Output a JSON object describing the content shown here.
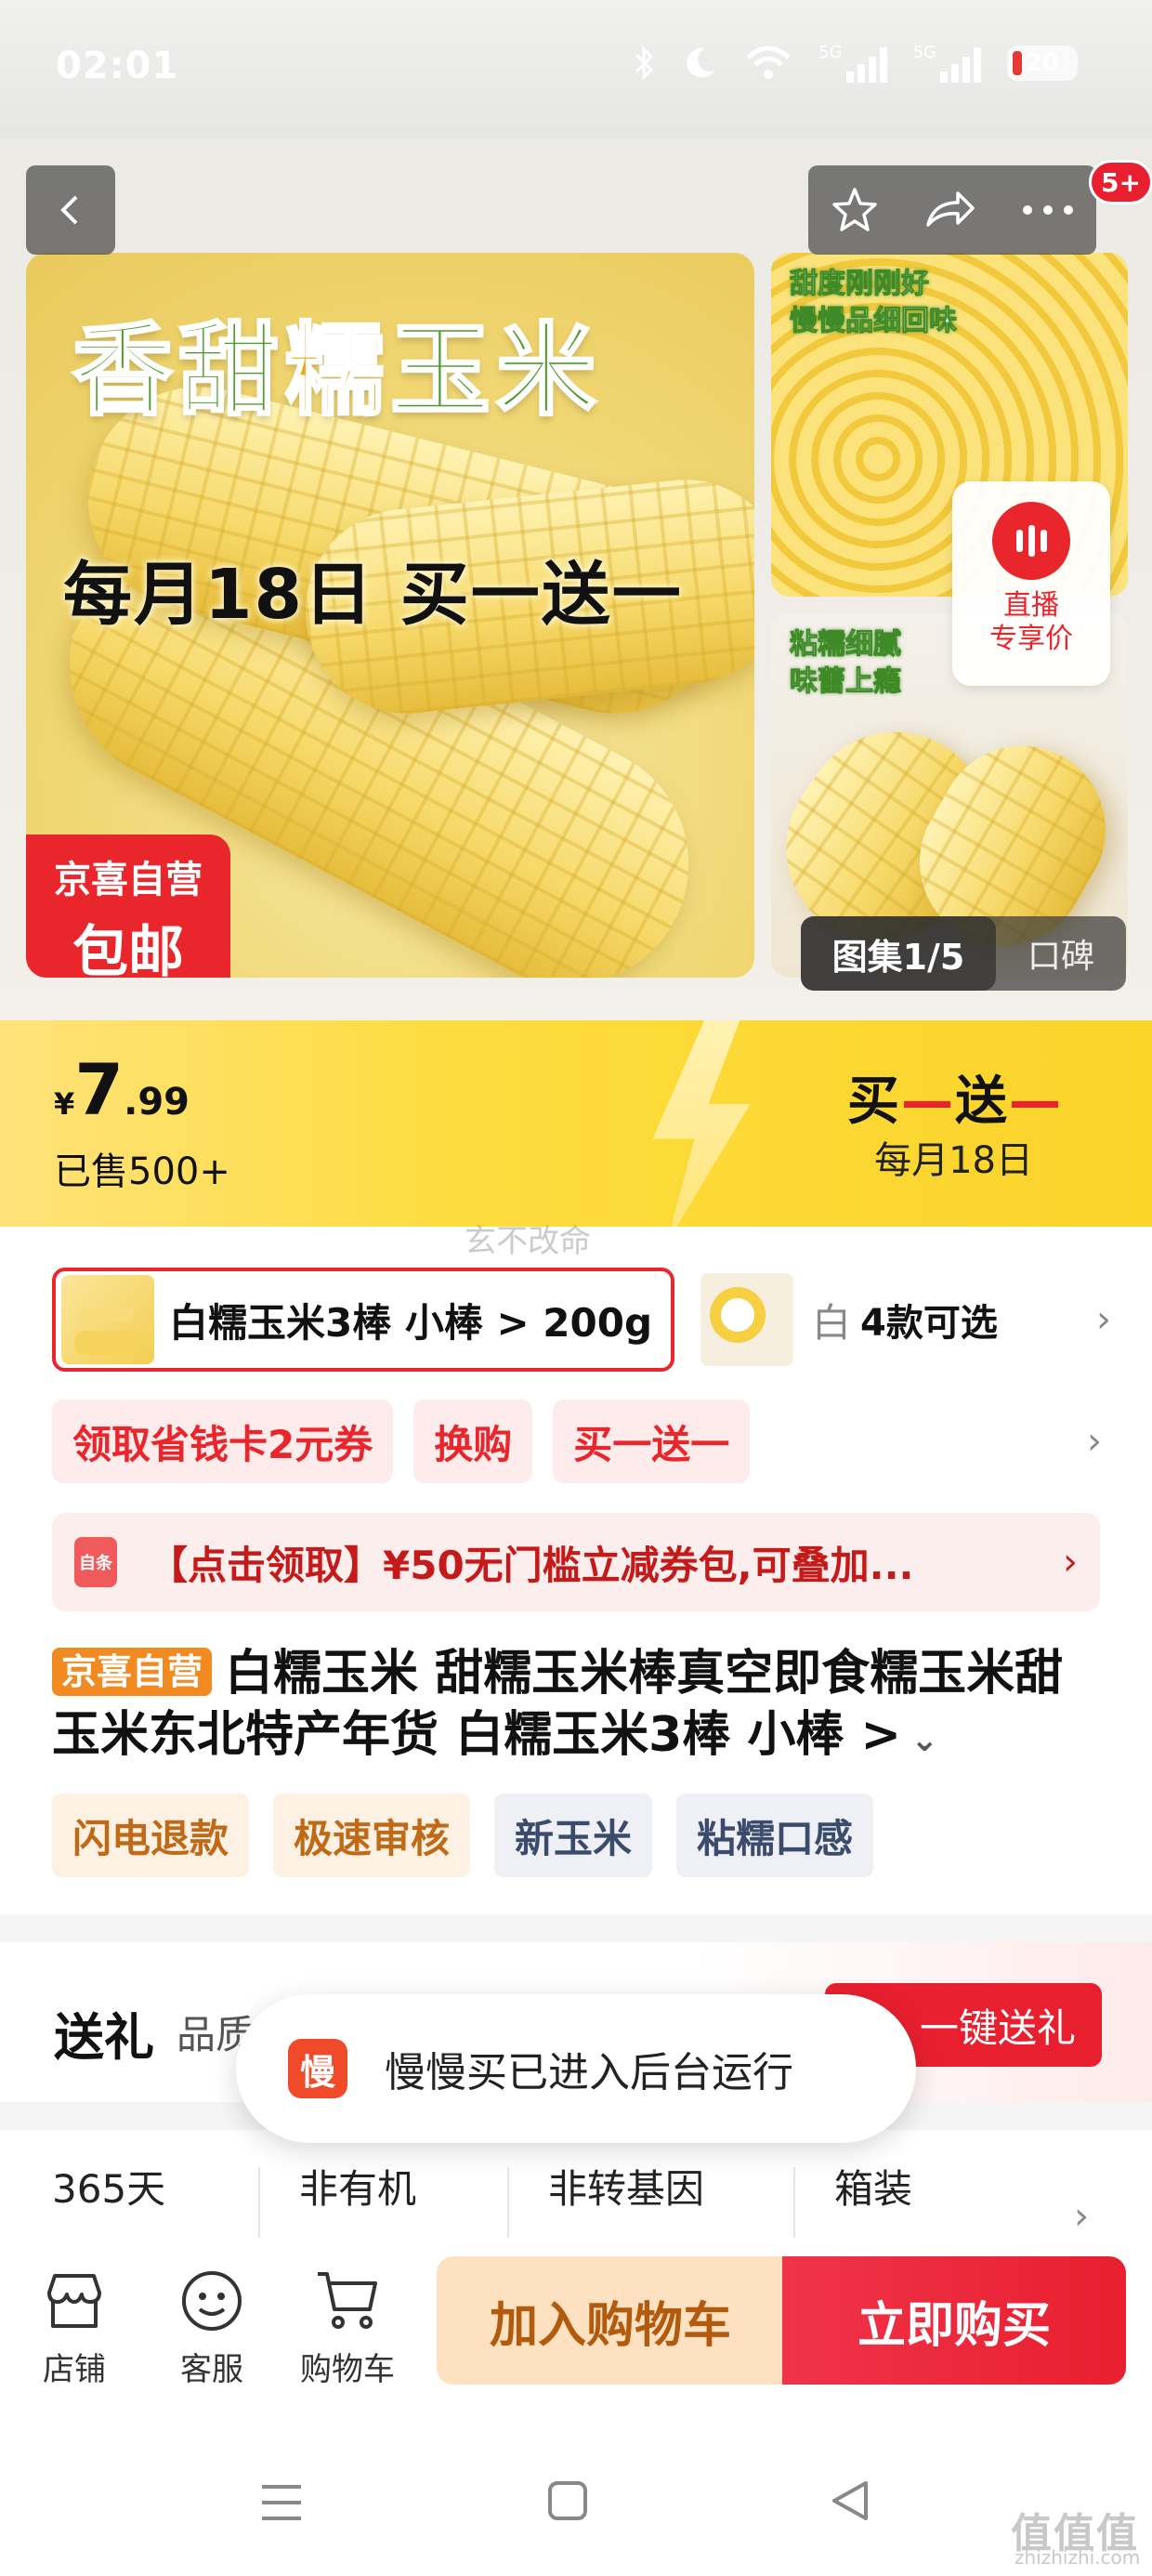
{
  "status_bar": {
    "time": "02:01",
    "battery": "20",
    "signal1": "5G",
    "signal2": "5G"
  },
  "nav": {
    "cart_badge": "5+"
  },
  "hero": {
    "main_title_a": "香甜",
    "main_title_hl": "糯",
    "main_title_b": "玉米",
    "promo": "每月18日 买一送一",
    "jx_line1": "京喜自营",
    "jx_line2": "包邮",
    "side1_caption_l1": "甜度刚刚好",
    "side1_caption_l2": "慢慢品细回味",
    "side2_caption_l1": "粘糯细腻",
    "side2_caption_l2": "味蕾上瘾",
    "live_l1": "直播",
    "live_l2": "专享价",
    "gallery": "图集1/5",
    "reviews": "口碑"
  },
  "price_bar": {
    "currency": "¥",
    "price_int": "7",
    "price_dec": ".99",
    "sold": "已售500+",
    "deal_a": "买",
    "deal_b": "送",
    "deal_date": "每月18日"
  },
  "watermark": "玄不改命",
  "variants": {
    "selected": "白糯玉米3棒 小棒 > 200g",
    "partial": "白",
    "more": "4款可选"
  },
  "promo_tags": [
    "领取省钱卡2元券",
    "换购",
    "买一送一"
  ],
  "coupon": {
    "icon": "自条",
    "text": "【点击领取】¥50无门槛立减券包,可叠加..."
  },
  "product": {
    "badge": "京喜自营",
    "title": "白糯玉米 甜糯玉米棒真空即食糯玉米甜玉米东北特产年货 白糯玉米3棒 小棒 >"
  },
  "feature_tags": [
    {
      "label": "闪电退款",
      "style": "o"
    },
    {
      "label": "极速审核",
      "style": "o"
    },
    {
      "label": "新玉米",
      "style": "g"
    },
    {
      "label": "粘糯口感",
      "style": "g"
    }
  ],
  "gift": {
    "label": "送礼",
    "sub": "品质",
    "button": "一键送礼"
  },
  "specs": [
    "365天",
    "非有机",
    "非转基因",
    "箱装"
  ],
  "toast": {
    "icon": "慢",
    "text": "慢慢买已进入后台运行"
  },
  "bottom_bar": {
    "store": "店铺",
    "service": "客服",
    "cart": "购物车",
    "add_cart": "加入购物车",
    "buy_now": "立即购买"
  },
  "site_watermark": {
    "big": "值值值",
    "small": "zhizhizhi.com"
  },
  "colors": {
    "accent_red": "#e8262b",
    "price_yellow": "#fddc3e",
    "cart_orange": "#fde1c0"
  }
}
